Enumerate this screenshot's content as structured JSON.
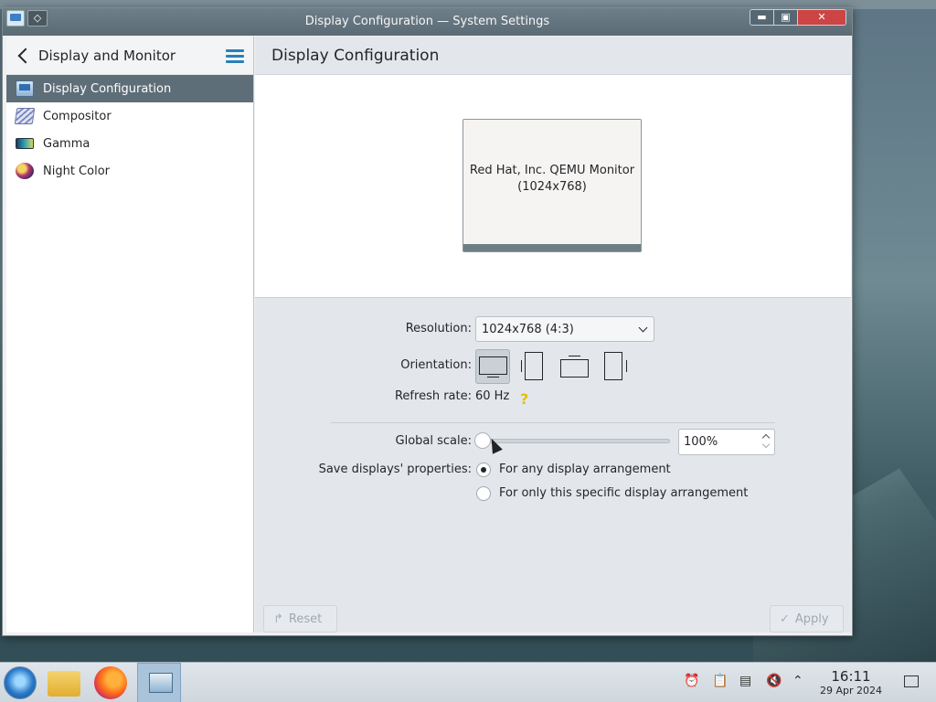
{
  "window": {
    "title": "Display Configuration — System Settings",
    "controls": {
      "minimize": "▬",
      "maximize": "▣",
      "close": "✕"
    }
  },
  "sidebar": {
    "title": "Display and Monitor",
    "items": [
      {
        "label": "Display Configuration",
        "icon": "display-icon",
        "active": true
      },
      {
        "label": "Compositor",
        "icon": "compositor-icon",
        "active": false
      },
      {
        "label": "Gamma",
        "icon": "gamma-icon",
        "active": false
      },
      {
        "label": "Night Color",
        "icon": "night-color-icon",
        "active": false
      }
    ]
  },
  "main": {
    "title": "Display Configuration",
    "monitor": {
      "name": "Red Hat, Inc. QEMU Monitor",
      "resolution": "(1024x768)"
    },
    "resolution": {
      "label": "Resolution:",
      "value": "1024x768 (4:3)"
    },
    "orientation": {
      "label": "Orientation:",
      "options": [
        "landscape",
        "portrait-left",
        "landscape-flipped",
        "portrait-right"
      ],
      "selected": "landscape"
    },
    "refresh": {
      "label": "Refresh rate:",
      "value": "60 Hz",
      "help": "?"
    },
    "scale": {
      "label": "Global scale:",
      "value": "100%",
      "slider_fraction": 0.0
    },
    "save": {
      "label": "Save displays' properties:",
      "options": [
        {
          "label": "For any display arrangement",
          "checked": true
        },
        {
          "label": "For only this specific display arrangement",
          "checked": false
        }
      ]
    },
    "buttons": {
      "reset": "Reset",
      "apply": "Apply"
    }
  },
  "taskbar": {
    "clock_time": "16:11",
    "clock_date": "29 Apr 2024",
    "tray_icons": [
      "notifications-icon",
      "clipboard-icon",
      "battery-icon",
      "volume-muted-icon",
      "chevron-up-icon"
    ]
  },
  "colors": {
    "accent": "#2980b9",
    "active_item_bg": "#5e6e78"
  }
}
